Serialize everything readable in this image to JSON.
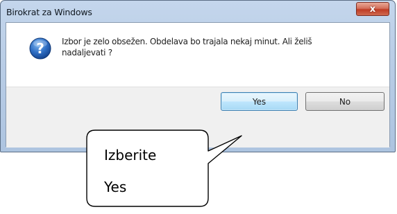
{
  "window": {
    "title": "Birokrat za Windows",
    "close_label": "x"
  },
  "dialog": {
    "icon": "question-icon",
    "message": "Izbor je zelo obsežen. Obdelava bo trajala nekaj minut. Ali želiš nadaljevati ?",
    "buttons": {
      "yes_label": "Yes",
      "no_label": "No"
    }
  },
  "annotation": {
    "line1": "Izberite",
    "line2": "Yes"
  },
  "colors": {
    "accent_button_border": "#3c7fb1",
    "close_button": "#c75a43",
    "window_frame": "#b9cde6"
  }
}
